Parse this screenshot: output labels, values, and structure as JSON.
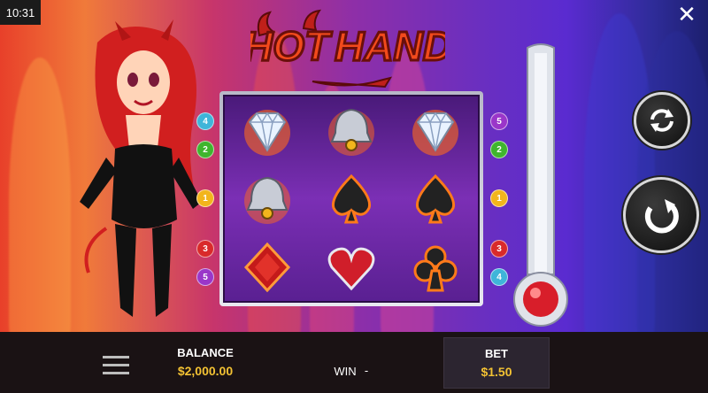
{
  "status": {
    "time": "10:31"
  },
  "game": {
    "title_line1": "HOT",
    "title_line2": "HAND"
  },
  "reels": [
    [
      "diamond",
      "bell",
      "diamond"
    ],
    [
      "bell",
      "spade",
      "spade"
    ],
    [
      "diamond-suit",
      "heart",
      "club"
    ]
  ],
  "paylines_left": [
    "4",
    "2",
    "1",
    "3",
    "5"
  ],
  "paylines_right": [
    "5",
    "2",
    "1",
    "3",
    "4"
  ],
  "payline_colors": {
    "1": "#f2b51c",
    "2": "#3fb52e",
    "3": "#d92a2a",
    "4": "#3fb5d9",
    "5": "#9a36c9"
  },
  "footer": {
    "balance_label": "BALANCE",
    "balance_value": "$2,000.00",
    "win_label": "WIN",
    "win_value": "-",
    "bet_label": "BET",
    "bet_value": "$1.50"
  },
  "icons": {
    "close": "close-icon",
    "menu": "menu-icon",
    "autoplay": "autoplay-icon",
    "spin": "spin-icon"
  }
}
